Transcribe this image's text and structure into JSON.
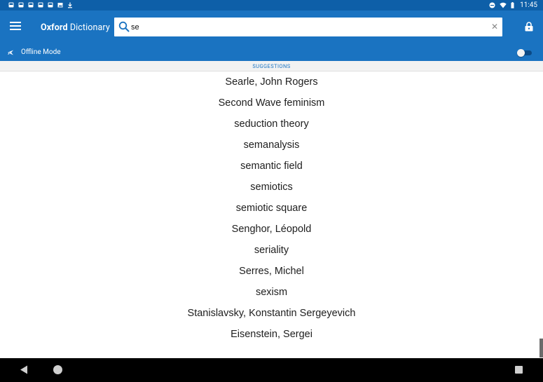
{
  "status_bar": {
    "time": "11:45"
  },
  "app_bar": {
    "title_bold": "Oxford",
    "title_light": "Dictionary",
    "search_value": "se",
    "clear_glyph": "✕",
    "offline_label": "Offline Mode",
    "offline_enabled": false
  },
  "suggestions": {
    "header": "SUGGESTIONS",
    "items": [
      "Searle, John Rogers",
      "Second Wave feminism",
      "seduction theory",
      "semanalysis",
      "semantic field",
      "semiotics",
      "semiotic square",
      "Senghor, Léopold",
      "seriality",
      "Serres, Michel",
      "sexism",
      "Stanislavsky, Konstantin Sergeyevich",
      "Eisenstein, Sergei"
    ]
  },
  "colors": {
    "app_bar": "#1a73c1",
    "status_bar": "#0e5fa8",
    "accent_text": "#1a73c1"
  },
  "icons": {
    "menu": "menu-icon",
    "search": "search-icon",
    "clear": "close-icon",
    "lock": "lock-icon",
    "offline": "airplane-icon",
    "back": "back-icon",
    "home": "home-icon",
    "recents": "recents-icon"
  }
}
